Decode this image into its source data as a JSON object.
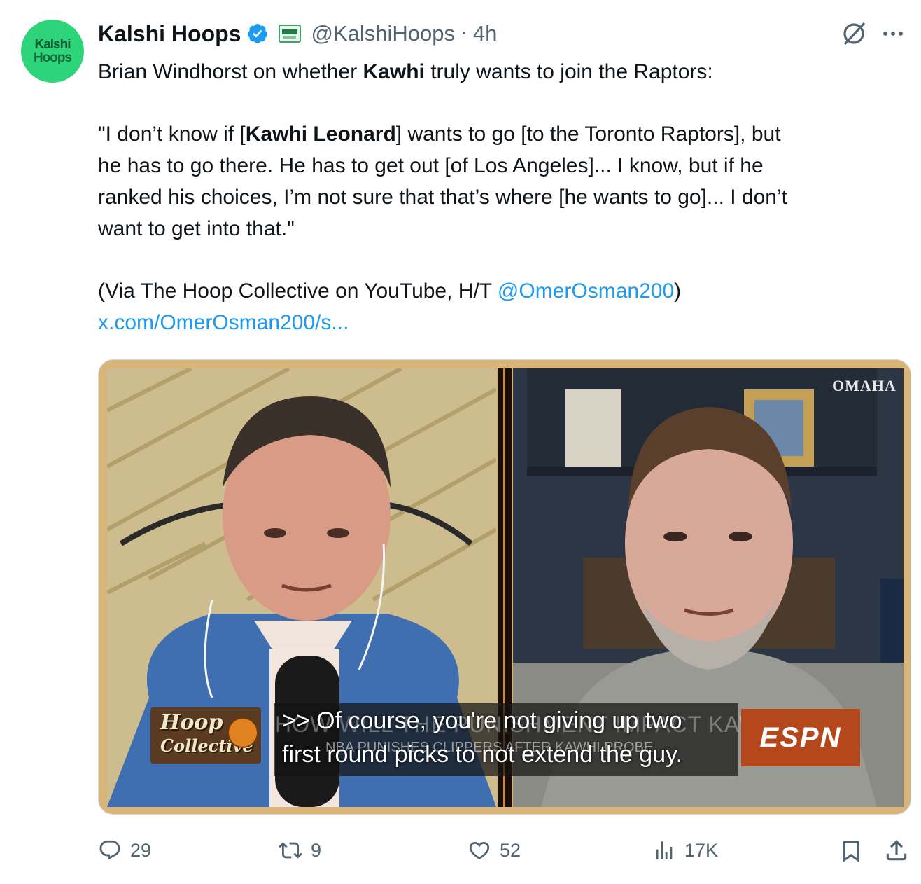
{
  "account": {
    "avatar_line1": "Kalshi",
    "avatar_line2": "Hoops",
    "display_name": "Kalshi Hoops",
    "handle": "@KalshiHoops",
    "separator": "·",
    "time_ago": "4h"
  },
  "tweet": {
    "line1_pre": "Brian Windhorst on whether ",
    "line1_bold": "Kawhi",
    "line1_post": " truly wants to join the Raptors:",
    "quote_pre": "\"I don’t know if [",
    "quote_bold": "Kawhi Leonard",
    "quote_l1_post": "] wants to go [to the Toronto Raptors], but",
    "quote_l2": "he has to go there. He has to get out [of Los Angeles]... I know, but if he",
    "quote_l3": "ranked his choices, I’m not sure that that’s where [he wants to go]... I don’t",
    "quote_l4": "want to get into that.\"",
    "via_pre": "(Via The Hoop Collective on YouTube, H/T ",
    "via_mention": "@OmerOsman200",
    "via_post": ")",
    "link": "x.com/OmerOsman200/s..."
  },
  "media": {
    "caption_line1": ">> Of course, you're not giving up two",
    "caption_line2": "first round picks to not extend the guy.",
    "lower_third_title": "HOW WILL THE PUNISHMENT IMPACT KAWHI?",
    "lower_third_sub": "NBA PUNISHES CLIPPERS AFTER KAWHI PROBE",
    "show_logo_line1": "Hoop",
    "show_logo_line2": "Collective",
    "network_logo": "ESPN",
    "corner_brand": "OMAHA"
  },
  "actions": {
    "replies": "29",
    "reposts": "9",
    "likes": "52",
    "views": "17K"
  },
  "colors": {
    "link": "#1d9bf0",
    "secondary_text": "#536471",
    "verified": "#1d9bf0",
    "avatar_bg": "#2ed47a"
  }
}
